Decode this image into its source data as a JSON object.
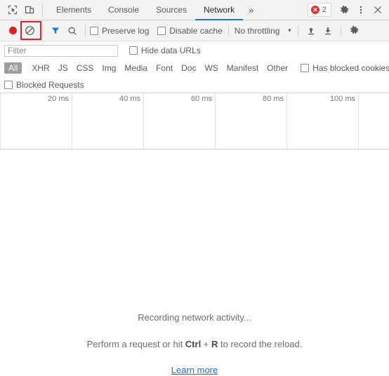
{
  "tabbar": {
    "inspect_icon": "inspect-cursor-icon",
    "device_icon": "device-toolbar-icon",
    "tabs": [
      {
        "label": "Elements",
        "active": false
      },
      {
        "label": "Console",
        "active": false
      },
      {
        "label": "Sources",
        "active": false
      },
      {
        "label": "Network",
        "active": true
      }
    ],
    "more_tabs": "»",
    "error_count": "2",
    "settings_icon": "gear-icon",
    "menu_icon": "kebab-menu-icon",
    "close_icon": "close-icon"
  },
  "toolbar": {
    "record_icon": "record-stop-icon",
    "clear_icon": "clear-circle-slash-icon",
    "filter_icon": "funnel-filter-icon",
    "search_icon": "search-icon",
    "preserve_log": "Preserve log",
    "disable_cache": "Disable cache",
    "throttling": "No throttling",
    "caret": "▼",
    "import_icon": "import-har-icon",
    "export_icon": "export-har-icon",
    "settings_icon": "network-settings-gear-icon"
  },
  "filter": {
    "placeholder": "Filter",
    "value": "",
    "hide_data_urls": "Hide data URLs"
  },
  "types": {
    "chips": [
      {
        "label": "All",
        "active": true
      },
      {
        "label": "XHR",
        "active": false
      },
      {
        "label": "JS",
        "active": false
      },
      {
        "label": "CSS",
        "active": false
      },
      {
        "label": "Img",
        "active": false
      },
      {
        "label": "Media",
        "active": false
      },
      {
        "label": "Font",
        "active": false
      },
      {
        "label": "Doc",
        "active": false
      },
      {
        "label": "WS",
        "active": false
      },
      {
        "label": "Manifest",
        "active": false
      },
      {
        "label": "Other",
        "active": false
      }
    ],
    "has_blocked_cookies": "Has blocked cookies",
    "blocked_requests": "Blocked Requests"
  },
  "overview": {
    "ticks": [
      "20 ms",
      "40 ms",
      "60 ms",
      "80 ms",
      "100 ms"
    ]
  },
  "empty_state": {
    "line1": "Recording network activity...",
    "line2_prefix": "Perform a request or hit ",
    "line2_key1": "Ctrl",
    "line2_plus": " + ",
    "line2_key2": "R",
    "line2_suffix": " to record the reload.",
    "learn_more": "Learn more"
  },
  "colors": {
    "accent_blue": "#1a73e8",
    "record_red": "#e02020",
    "error_red": "#e03131",
    "annotation_red": "#e8202a",
    "link_blue": "#1a6fd4",
    "chip_active_bg": "#9e9e9e"
  }
}
